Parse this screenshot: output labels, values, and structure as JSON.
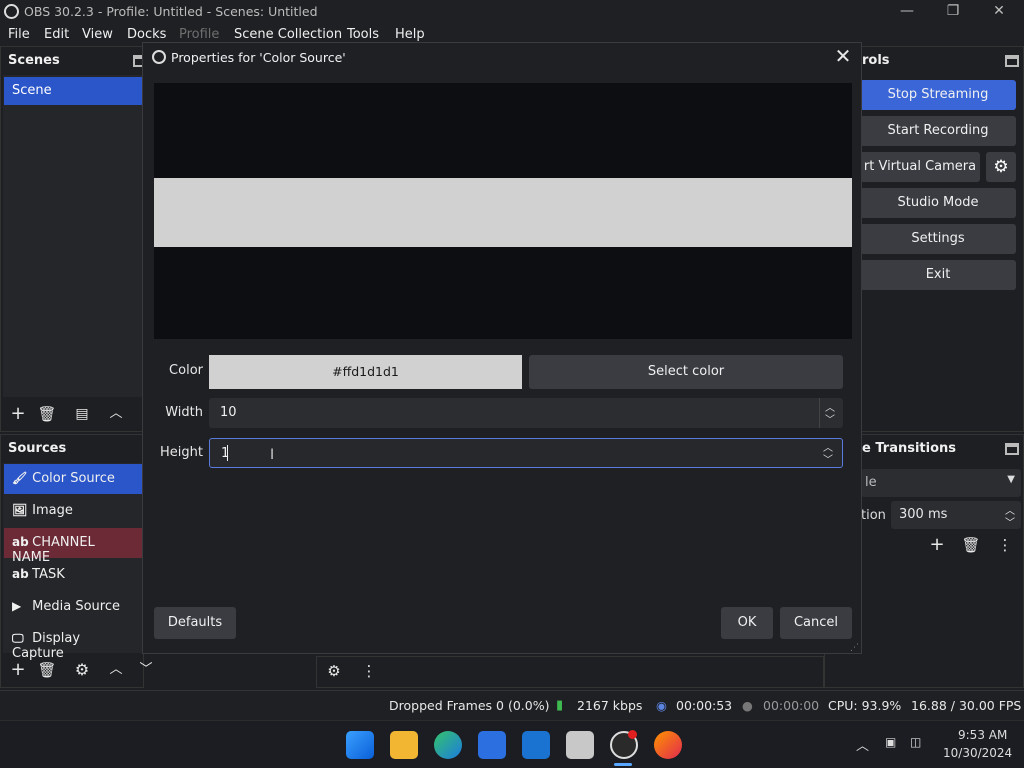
{
  "window": {
    "title": "OBS 30.2.3 - Profile: Untitled - Scenes: Untitled"
  },
  "menu": [
    "File",
    "Edit",
    "View",
    "Docks",
    "Profile",
    "Scene Collection",
    "Tools",
    "Help"
  ],
  "scenes": {
    "title": "Scenes",
    "items": [
      "Scene"
    ]
  },
  "sources": {
    "title": "Sources",
    "items": [
      {
        "label": "Color Source",
        "icon": "brush-icon",
        "glyph": "🖌"
      },
      {
        "label": "Image",
        "icon": "image-icon",
        "glyph": "🖼"
      },
      {
        "label": "CHANNEL NAME",
        "icon": "text-icon",
        "glyph": "ab"
      },
      {
        "label": "TASK",
        "icon": "text-icon",
        "glyph": "ab"
      },
      {
        "label": "Media Source",
        "icon": "play-icon",
        "glyph": "▶"
      },
      {
        "label": "Display Capture",
        "icon": "monitor-icon",
        "glyph": "🖵"
      }
    ]
  },
  "controls": {
    "title_partial": "rols",
    "stop_streaming": "Stop Streaming",
    "start_recording": "Start Recording",
    "virtual_camera": "rt Virtual Camera",
    "studio_mode": "Studio Mode",
    "settings": "Settings",
    "exit": "Exit"
  },
  "transitions": {
    "title_partial": "e Transitions",
    "select_partial": "le",
    "duration_label_partial": "tion",
    "duration_value": "300 ms"
  },
  "dialog": {
    "title": "Properties for 'Color Source'",
    "color_label": "Color",
    "color_value": "#ffd1d1d1",
    "select_color": "Select color",
    "width_label": "Width",
    "width_value": "10",
    "height_label": "Height",
    "height_value": "1",
    "defaults": "Defaults",
    "ok": "OK",
    "cancel": "Cancel"
  },
  "status": {
    "dropped_frames": "Dropped Frames 0 (0.0%)",
    "kbps": "2167 kbps",
    "stream_time": "00:00:53",
    "record_time": "00:00:00",
    "cpu": "CPU: 93.9%",
    "fps": "16.88 / 30.00 FPS"
  },
  "clock": {
    "time": "9:53 AM",
    "date": "10/30/2024"
  },
  "colors": {
    "accent": "#2b56c9",
    "swatch": "#d1d1d1",
    "live": "#3a66d8"
  }
}
